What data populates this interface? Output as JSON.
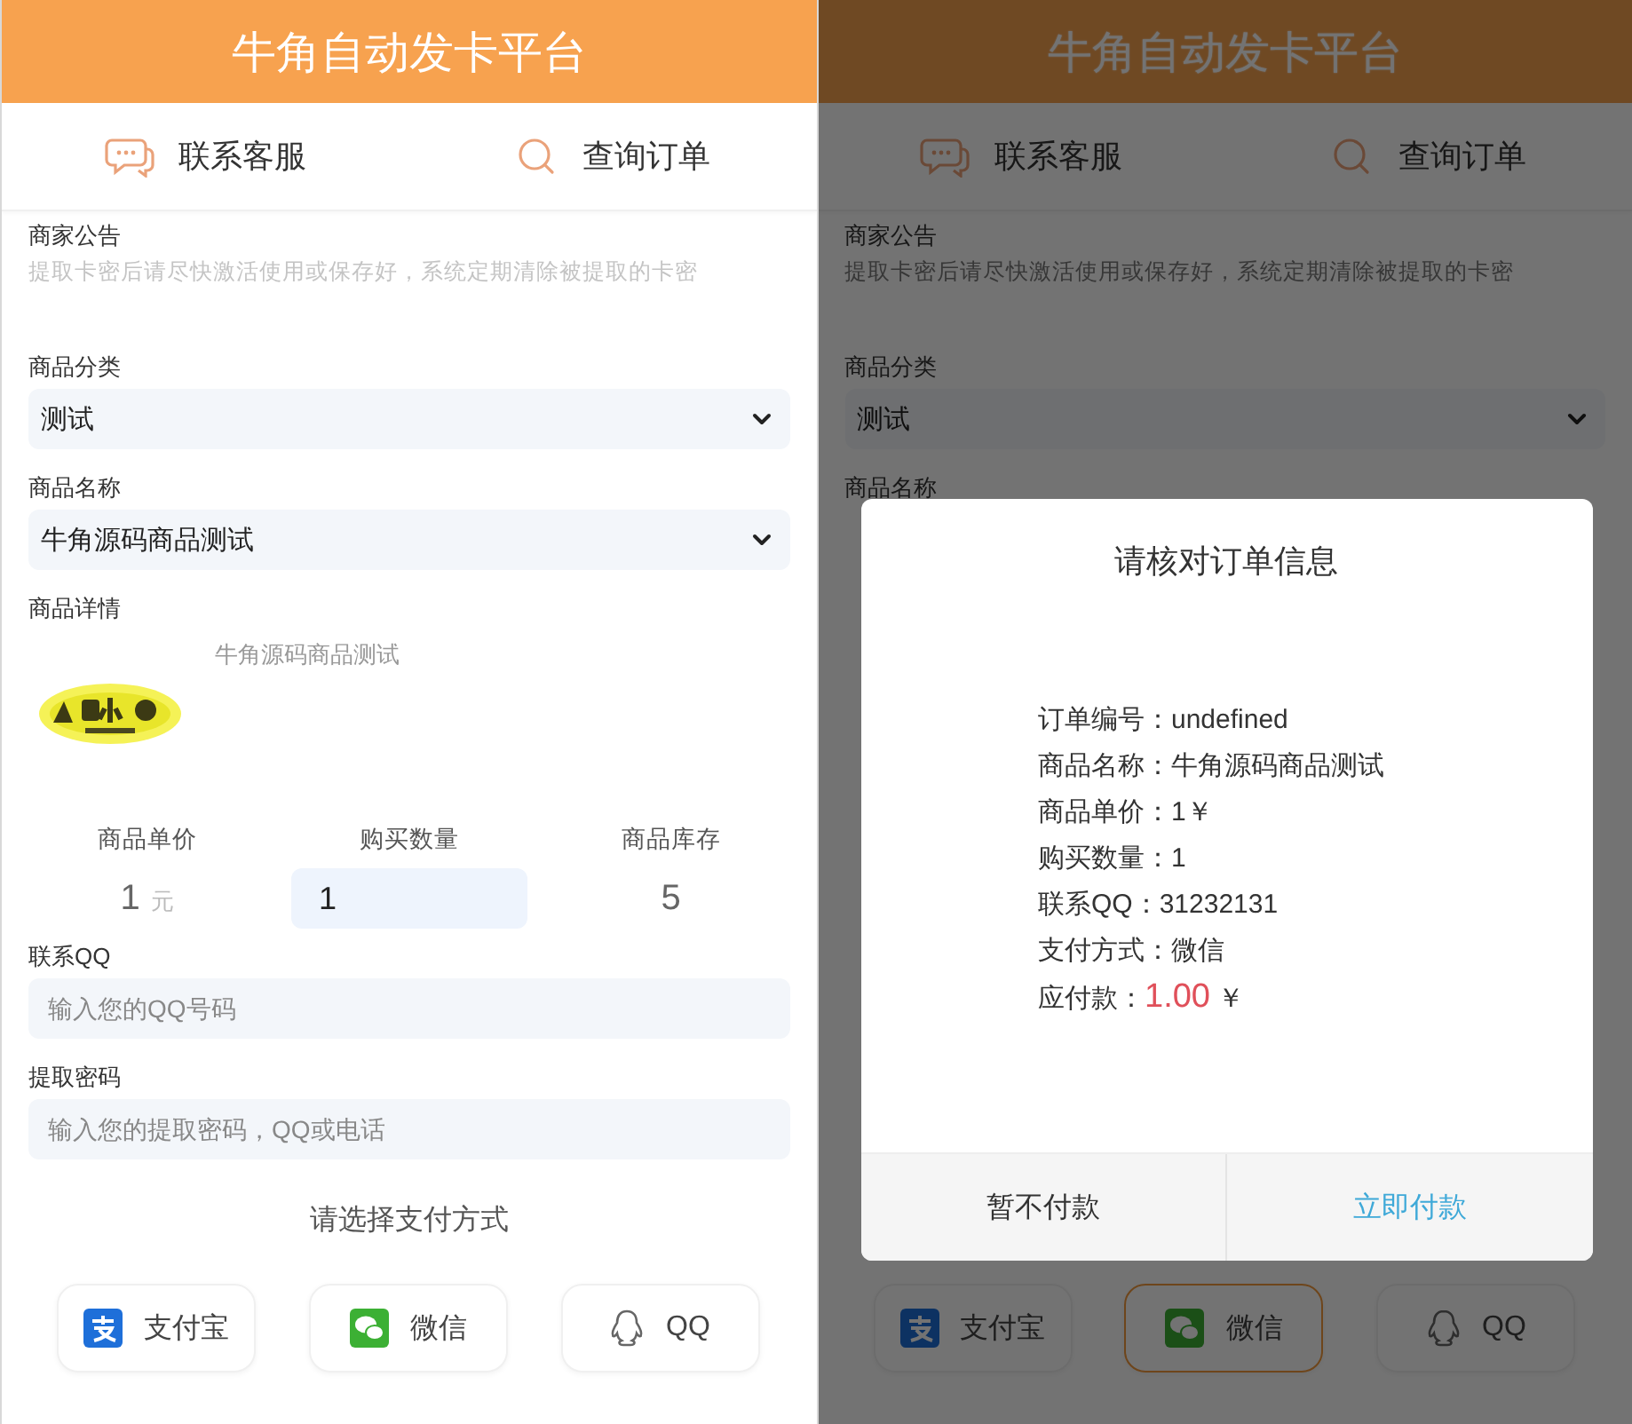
{
  "screens": [
    {
      "header_title": "牛角自动发卡平台",
      "nav": [
        {
          "kind": "chat",
          "label": "联系客服"
        },
        {
          "kind": "search",
          "label": "查询订单"
        }
      ],
      "notice": {
        "label": "商家公告",
        "text": "提取卡密后请尽快激活使用或保存好，系统定期清除被提取的卡密"
      },
      "category": {
        "label": "商品分类",
        "value": "测试"
      },
      "product": {
        "label": "商品名称",
        "value": "牛角源码商品测试"
      },
      "detail": {
        "label": "商品详情",
        "text": "牛角源码商品测试"
      },
      "stats": {
        "price_label": "商品单价",
        "price": "1",
        "price_unit": "元",
        "qty_label": "购买数量",
        "qty_value": "1",
        "stock_label": "商品库存",
        "stock": "5"
      },
      "qq": {
        "label": "联系QQ",
        "placeholder": "输入您的QQ号码"
      },
      "password": {
        "label": "提取密码",
        "placeholder": "输入您的提取密码，QQ或电话"
      },
      "payment": {
        "title": "请选择支付方式",
        "methods": [
          {
            "kind": "alipay",
            "label": "支付宝",
            "selected": false
          },
          {
            "kind": "wechat",
            "label": "微信",
            "selected": false
          },
          {
            "kind": "qq",
            "label": "QQ",
            "selected": false
          }
        ]
      }
    },
    {
      "header_title": "牛角自动发卡平台",
      "nav": [
        {
          "kind": "chat",
          "label": "联系客服"
        },
        {
          "kind": "search",
          "label": "查询订单"
        }
      ],
      "notice": {
        "label": "商家公告",
        "text": "提取卡密后请尽快激活使用或保存好，系统定期清除被提取的卡密"
      },
      "category": {
        "label": "商品分类",
        "value": "测试"
      },
      "product": {
        "label": "商品名称"
      },
      "payment": {
        "methods": [
          {
            "kind": "alipay",
            "label": "支付宝",
            "selected": false
          },
          {
            "kind": "wechat",
            "label": "微信",
            "selected": true
          },
          {
            "kind": "qq",
            "label": "QQ",
            "selected": false
          }
        ]
      },
      "modal": {
        "title": "请核对订单信息",
        "lines": [
          {
            "label": "订单编号：",
            "value": "undefined"
          },
          {
            "label": "商品名称：",
            "value": "牛角源码商品测试"
          },
          {
            "label": "商品单价：",
            "value": "1￥"
          },
          {
            "label": "购买数量：",
            "value": "1"
          },
          {
            "label": "联系QQ：",
            "value": "31232131"
          },
          {
            "label": "支付方式：",
            "value": "微信"
          }
        ],
        "due": {
          "label": "应付款：",
          "amount": "1.00",
          "unit": "￥"
        },
        "buttons": [
          {
            "kind": "cancel",
            "label": "暂不付款"
          },
          {
            "kind": "confirm",
            "label": "立即付款"
          }
        ]
      }
    }
  ]
}
